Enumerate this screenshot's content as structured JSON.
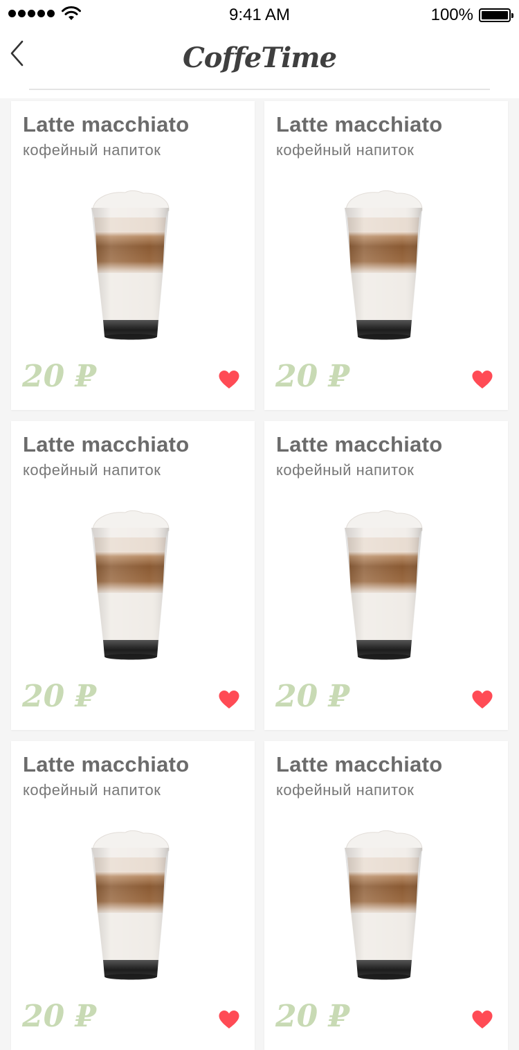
{
  "status_bar": {
    "time": "9:41 AM",
    "battery": "100%",
    "icons": [
      "signal-dots-icon",
      "wifi-icon",
      "battery-icon"
    ]
  },
  "header": {
    "title": "CoffeTime",
    "back_icon": "chevron-left-icon"
  },
  "colors": {
    "price": "#c8dab4",
    "heart": "#ff4b55",
    "text_primary": "#6b6b6b"
  },
  "products": [
    {
      "name": "Latte macchiato",
      "subtitle": "кофейный напиток",
      "price": "20 ₽",
      "favorite": true
    },
    {
      "name": "Latte macchiato",
      "subtitle": "кофейный напиток",
      "price": "20 ₽",
      "favorite": true
    },
    {
      "name": "Latte macchiato",
      "subtitle": "кофейный напиток",
      "price": "20 ₽",
      "favorite": true
    },
    {
      "name": "Latte macchiato",
      "subtitle": "кофейный напиток",
      "price": "20 ₽",
      "favorite": true
    },
    {
      "name": "Latte macchiato",
      "subtitle": "кофейный напиток",
      "price": "20 ₽",
      "favorite": true
    },
    {
      "name": "Latte macchiato",
      "subtitle": "кофейный напиток",
      "price": "20 ₽",
      "favorite": true
    }
  ]
}
